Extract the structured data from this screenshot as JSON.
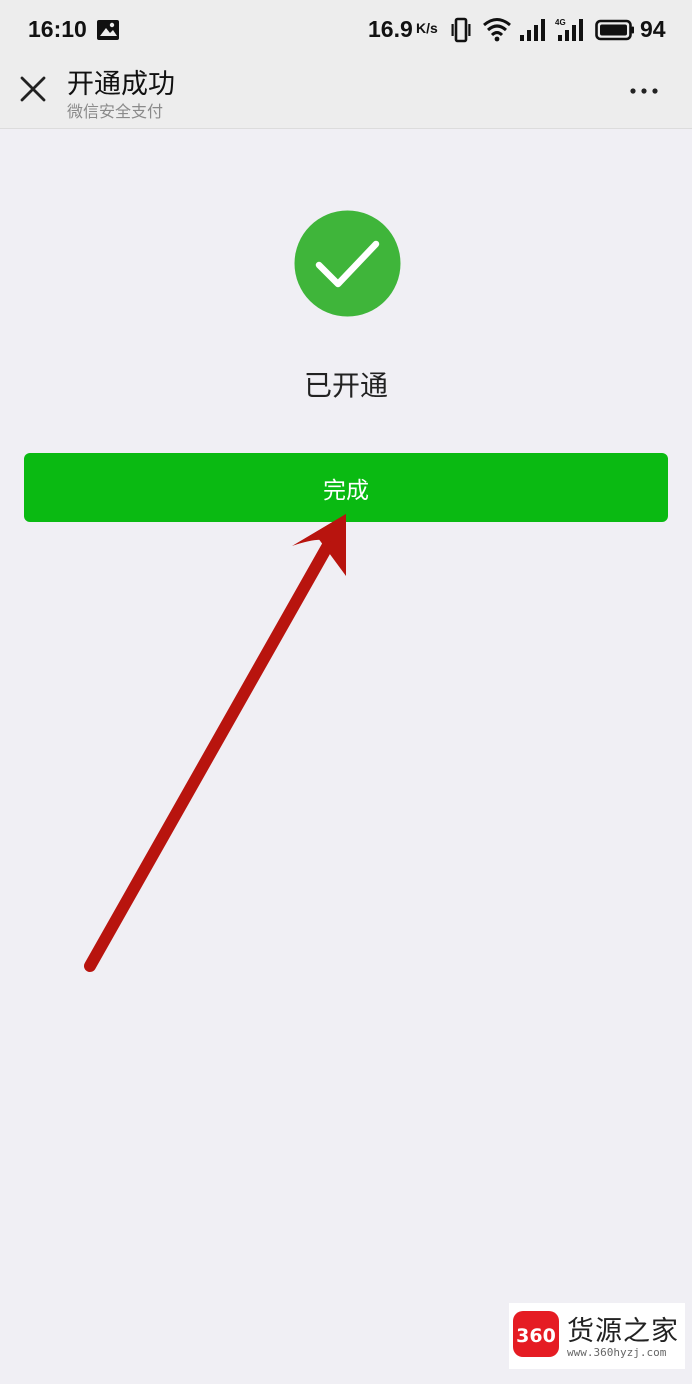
{
  "status_bar": {
    "time": "16:10",
    "net_speed": "16.9",
    "net_speed_unit": "K/s",
    "battery_level": "94",
    "icons": [
      "image-notification-icon",
      "vibrate-icon",
      "wifi-icon",
      "signal-icon",
      "signal-4g-icon",
      "battery-icon"
    ]
  },
  "header": {
    "title": "开通成功",
    "subtitle": "微信安全支付",
    "close_icon": "close-icon",
    "more_icon": "more-icon"
  },
  "main": {
    "status_icon": "check-circle-icon",
    "status_text": "已开通",
    "done_button_label": "完成"
  },
  "colors": {
    "success_green": "#3fb53a",
    "button_green": "#0aba12",
    "annotation_red": "#b8140e",
    "background": "#f0eff4"
  },
  "watermark": {
    "logo_text": "360",
    "brand": "货源之家",
    "url": "www.360hyzj.com"
  }
}
